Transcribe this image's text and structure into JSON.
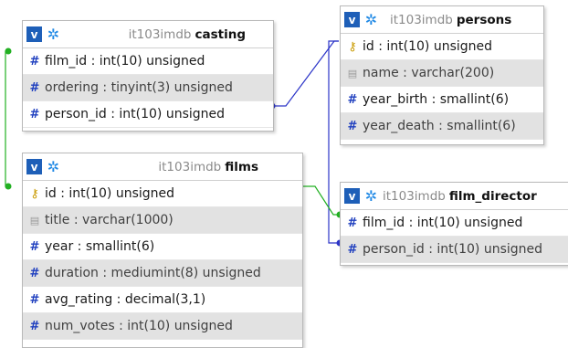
{
  "tables": {
    "casting": {
      "db": "it103imdb",
      "name": "casting",
      "columns": [
        {
          "label": "film_id : int(10) unsigned",
          "icon": "hash-icon"
        },
        {
          "label": "ordering : tinyint(3) unsigned",
          "icon": "hash-icon"
        },
        {
          "label": "person_id : int(10) unsigned",
          "icon": "hash-icon"
        }
      ]
    },
    "persons": {
      "db": "it103imdb",
      "name": "persons",
      "columns": [
        {
          "label": "id : int(10) unsigned",
          "icon": "key-icon"
        },
        {
          "label": "name : varchar(200)",
          "icon": "text-icon"
        },
        {
          "label": "year_birth : smallint(6)",
          "icon": "hash-icon"
        },
        {
          "label": "year_death : smallint(6)",
          "icon": "hash-icon"
        }
      ]
    },
    "films": {
      "db": "it103imdb",
      "name": "films",
      "columns": [
        {
          "label": "id : int(10) unsigned",
          "icon": "key-icon"
        },
        {
          "label": "title : varchar(1000)",
          "icon": "text-icon"
        },
        {
          "label": "year : smallint(6)",
          "icon": "hash-icon"
        },
        {
          "label": "duration : mediumint(8) unsigned",
          "icon": "hash-icon"
        },
        {
          "label": "avg_rating : decimal(3,1)",
          "icon": "hash-icon"
        },
        {
          "label": "num_votes : int(10) unsigned",
          "icon": "hash-icon"
        }
      ]
    },
    "film_directors": {
      "db": "it103imdb",
      "name": "film_director",
      "columns": [
        {
          "label": "film_id : int(10) unsigned",
          "icon": "hash-icon"
        },
        {
          "label": "person_id : int(10) unsigned",
          "icon": "hash-icon"
        }
      ]
    }
  },
  "toggle_label": "v",
  "colors": {
    "link_films": "#22b022",
    "link_persons": "#2c35c8",
    "header_toggle": "#1e5fb8",
    "hash_icon": "#1f3fbf"
  }
}
